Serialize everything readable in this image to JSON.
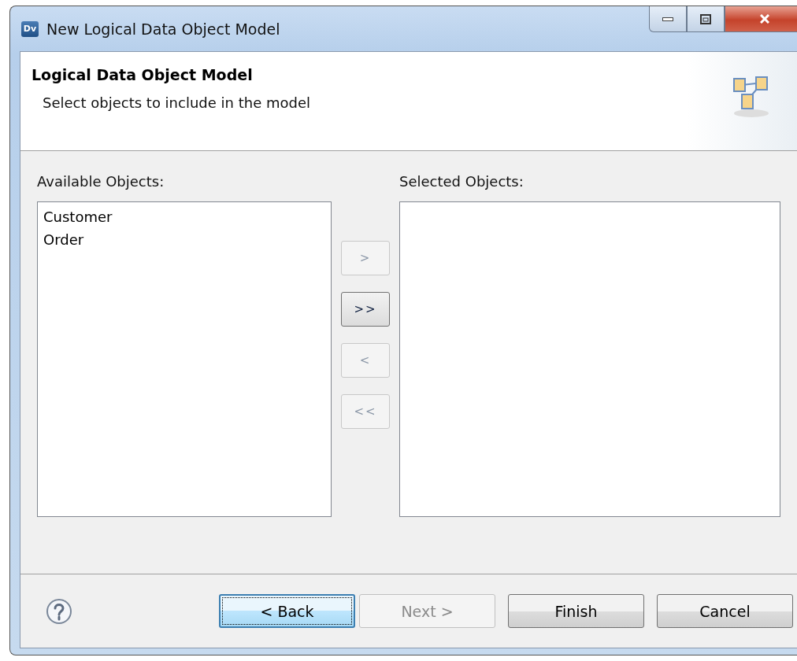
{
  "window": {
    "title": "New Logical Data Object Model",
    "app_icon": "Dv"
  },
  "header": {
    "title": "Logical Data Object Model",
    "subtitle": "Select objects to include in the model"
  },
  "available": {
    "label": "Available Objects:",
    "items": [
      {
        "text": "Customer",
        "selected": false
      },
      {
        "text": "Order",
        "selected": false
      }
    ]
  },
  "move_buttons": [
    {
      "label": ">",
      "disabled": true
    },
    {
      "label": ">>",
      "disabled": false
    },
    {
      "label": "<",
      "disabled": true
    },
    {
      "label": "<<",
      "disabled": true
    }
  ],
  "selected": {
    "label": "Selected Objects:"
  },
  "buttons": [
    {
      "label": "< Back",
      "disabled": false,
      "default": true
    },
    {
      "label": "Next >",
      "disabled": true,
      "default": false
    },
    {
      "label": "Finish",
      "disabled": false,
      "default": false
    },
    {
      "label": "Cancel",
      "disabled": false,
      "default": false
    }
  ]
}
